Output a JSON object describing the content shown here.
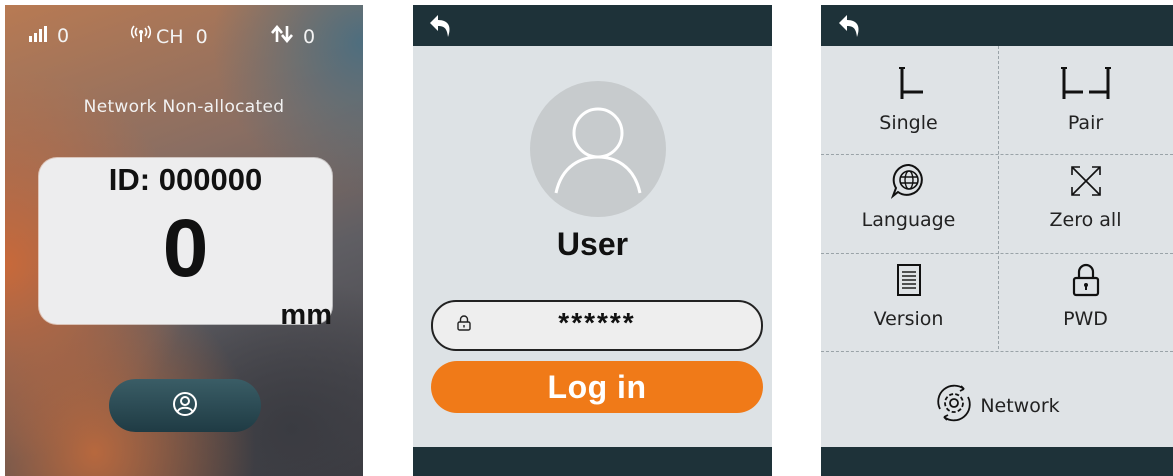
{
  "screen1": {
    "status": {
      "signal_value": "0",
      "channel_label": "CH",
      "channel_value": "0",
      "traffic_value": "0"
    },
    "network_message": "Network Non-allocated",
    "card": {
      "id_label": "ID:",
      "id_value": "000000",
      "value": "0",
      "unit": "mm"
    }
  },
  "screen2": {
    "username": "User",
    "password_value": "******",
    "login_label": "Log in"
  },
  "screen3": {
    "menu": {
      "single": "Single",
      "pair": "Pair",
      "language": "Language",
      "zero_all": "Zero all",
      "version": "Version",
      "pwd": "PWD",
      "network": "Network"
    }
  }
}
